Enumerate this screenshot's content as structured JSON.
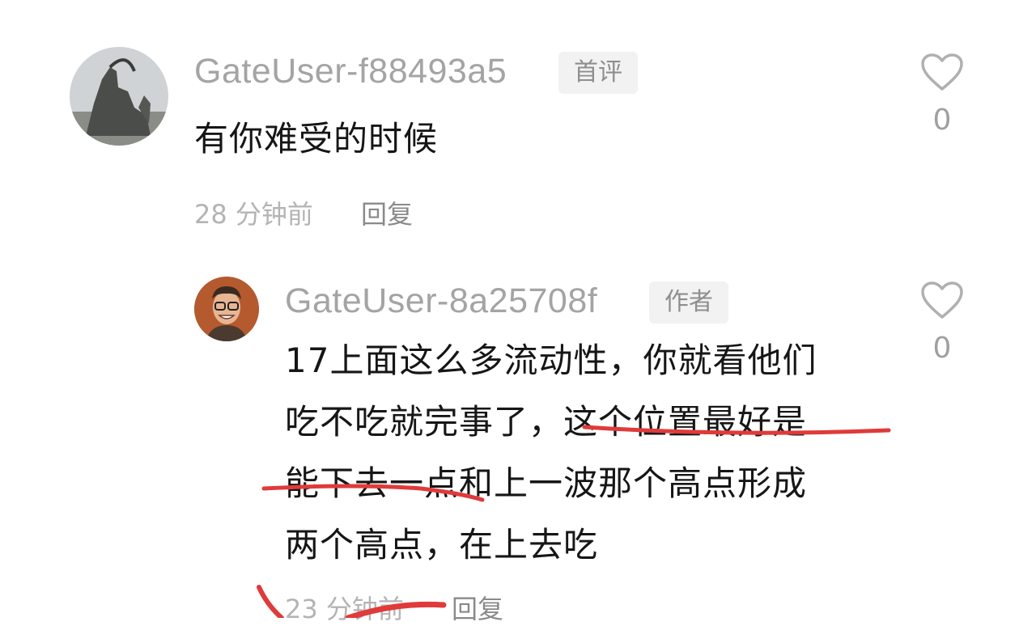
{
  "comments": [
    {
      "username": "GateUser-f88493a5",
      "badge": "首评",
      "text": "有你难受的时候",
      "time": "28 分钟前",
      "reply_label": "回复",
      "likes": "0",
      "avatar_icon": "statue-avatar",
      "like_icon": "heart-outline-icon"
    },
    {
      "username": "GateUser-8a25708f",
      "badge": "作者",
      "text_lines": [
        "17上面这么多流动性，你就看他们",
        "吃不吃就完事了，这个位置最好是",
        "能下去一点和上一波那个高点形成",
        "两个高点，在上去吃"
      ],
      "time": "23 分钟前",
      "reply_label": "回复",
      "likes": "0",
      "avatar_icon": "smiling-man-avatar",
      "like_icon": "heart-outline-icon"
    }
  ],
  "colors": {
    "username": "#a4a4a4",
    "body_text": "#161616",
    "badge_bg": "#f2f2f2",
    "underline_mark": "#e03a3a"
  }
}
